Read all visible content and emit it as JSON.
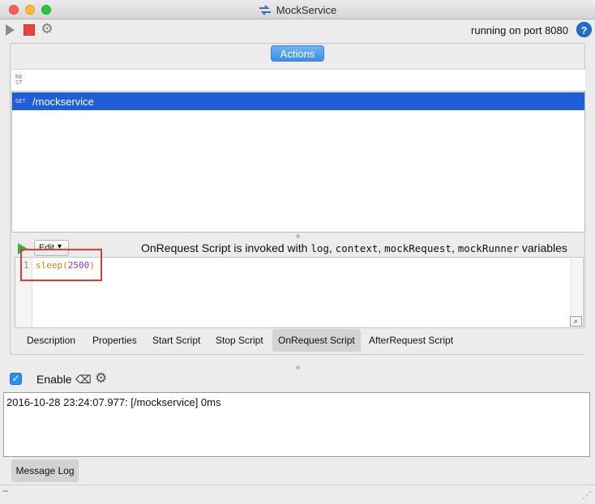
{
  "window": {
    "title": "MockService"
  },
  "toolbar": {
    "status": "running on port 8080",
    "help_label": "?"
  },
  "actions_button": "Actions",
  "rest_icon_text": "RE\nST",
  "operations": [
    {
      "method": "GET",
      "path": "/mockservice"
    }
  ],
  "script_toolbar": {
    "edit_label": "Edit",
    "hint_prefix": "OnRequest Script is invoked with ",
    "hint_vars": [
      "log",
      "context",
      "mockRequest",
      "mockRunner"
    ],
    "hint_suffix": " variables"
  },
  "editor": {
    "line_number": "1",
    "code_fn": "sleep(",
    "code_num": "2500",
    "code_close": ")"
  },
  "tabs": [
    {
      "label": "Description",
      "active": false
    },
    {
      "label": "Properties",
      "active": false
    },
    {
      "label": "Start Script",
      "active": false
    },
    {
      "label": "Stop Script",
      "active": false
    },
    {
      "label": "OnRequest Script",
      "active": true
    },
    {
      "label": "AfterRequest Script",
      "active": false
    }
  ],
  "enable": {
    "label": "Enable",
    "checked": true
  },
  "log": {
    "entries": [
      "2016-10-28 23:24:07.977: [/mockservice] 0ms"
    ],
    "tab_label": "Message Log"
  },
  "statusbar": {
    "text": "--"
  },
  "colors": {
    "selection": "#1e5fd8",
    "accent": "#3d8ee8",
    "highlight_box": "#e03a3a",
    "play_green": "#2fb33a"
  }
}
